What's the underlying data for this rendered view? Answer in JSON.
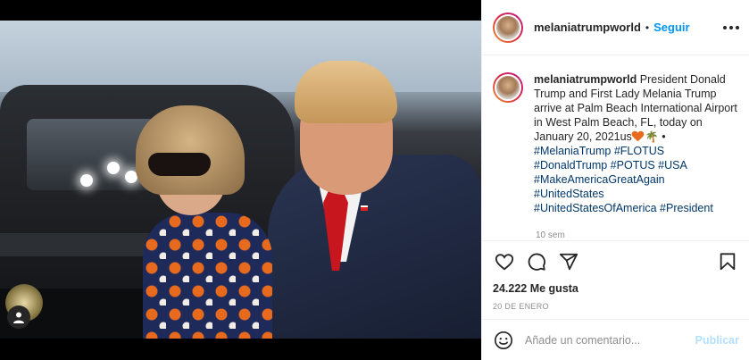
{
  "post": {
    "username": "melaniatrumpworld",
    "header_separator": "•",
    "follow_label": "Seguir",
    "caption": {
      "username": "melaniatrumpworld",
      "text_before_emoji": "President Donald Trump and First Lady Melania Trump arrive at Palm Beach International Airport in West Palm Beach, FL, today on January 20, 2021us",
      "emoji_separator": "•",
      "hashtag_lines": [
        "#MelaniaTrump #FLOTUS",
        "#DonaldTrump #POTUS #USA",
        "#MakeAmericaGreatAgain",
        "#UnitedStates",
        "#UnitedStatesOfAmerica #President"
      ]
    },
    "time_ago": "10 sem",
    "likes": "24.222 Me gusta",
    "date": "20 DE ENERO",
    "comment_placeholder": "Añade un comentario...",
    "publish_label": "Publicar"
  },
  "icons": {
    "like": "heart-icon",
    "comment": "comment-icon",
    "share": "send-icon",
    "save": "bookmark-icon",
    "more": "more-options-icon",
    "emoji": "smile-icon",
    "tagged_users": "user-icon"
  },
  "colors": {
    "link_blue": "#0095f6",
    "hashtag": "#00376b",
    "publish_disabled": "#b2dffc",
    "meta_gray": "#8e8e8e"
  }
}
